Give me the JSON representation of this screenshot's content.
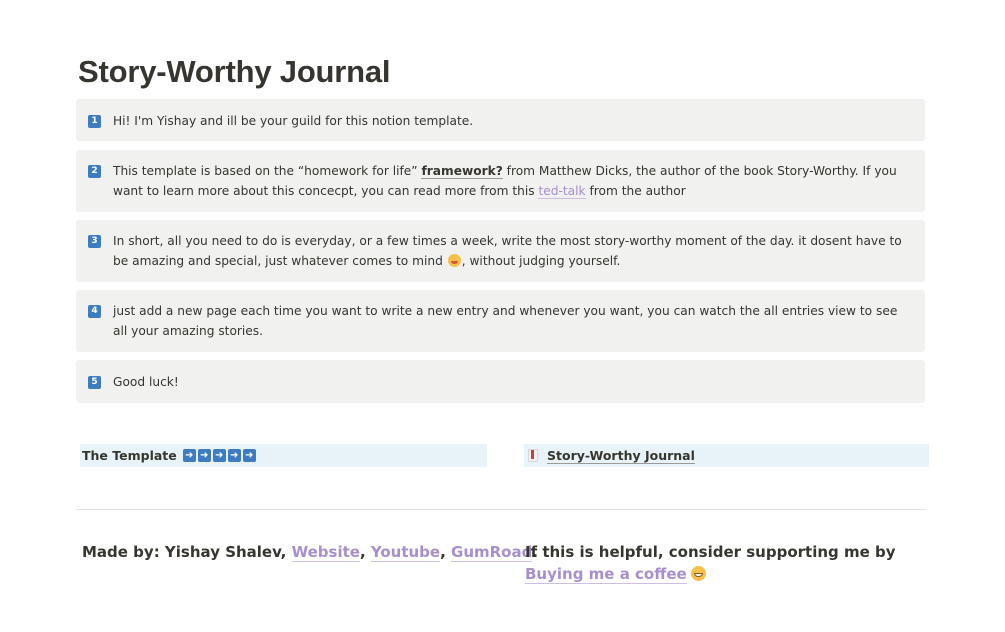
{
  "page": {
    "title": "Story-Worthy Journal"
  },
  "callouts": [
    {
      "number": "1",
      "text": "Hi! I'm Yishay and ill be your guild for this notion template."
    },
    {
      "number": "2",
      "text_before": "This template is based on the “homework for life” ",
      "link_framework": "framework?",
      "text_middle": " from Matthew Dicks, the author of the book Story-Worthy. If you want to learn more about this concecpt, you can read more from this ",
      "link_talk": "ted-talk",
      "text_after": " from the author"
    },
    {
      "number": "3",
      "text_before": "In short, all you need to do is everyday, or a few times a week, write the most story-worthy moment of the day. it dosent have to be amazing and special, just whatever comes to mind ",
      "text_after": ", without judging yourself."
    },
    {
      "number": "4",
      "text": "just add a new page each time you want to write a new entry and whenever you want, you can watch the all entries view to see all your amazing stories."
    },
    {
      "number": "5",
      "text": "Good luck!"
    }
  ],
  "embeds": {
    "template_label": "The Template",
    "arrow_glyph": "➜",
    "journal_link": "Story-Worthy Journal"
  },
  "footer": {
    "made_by": "Made by: Yishay Shalev, ",
    "website": "Website",
    "sep1": ", ",
    "youtube": "Youtube",
    "sep2": ", ",
    "gumroad": "GumRoad",
    "end": ".",
    "support_text": "If this is helpful, consider supporting me by ",
    "coffee_link": "Buying me a coffee"
  },
  "colors": {
    "text": "#37352f",
    "callout_bg": "#f1f1ef",
    "number_badge": "#3d7cc0",
    "link_purple": "#a78fcd",
    "embed_bg": "#e7f3f8"
  }
}
